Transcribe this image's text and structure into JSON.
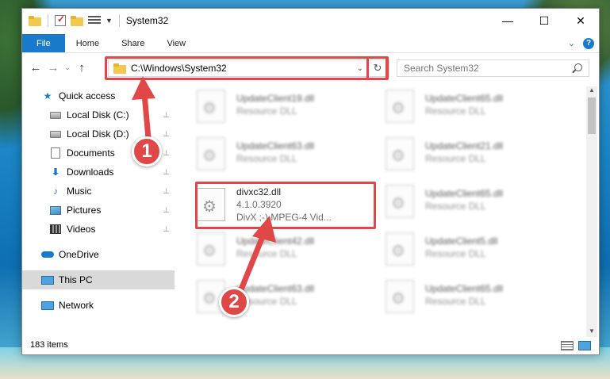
{
  "window": {
    "title": "System32",
    "controls": {
      "minimize": "—",
      "maximize": "☐",
      "close": "✕"
    }
  },
  "ribbon": {
    "tabs": [
      "File",
      "Home",
      "Share",
      "View"
    ],
    "expand": "⌄",
    "help": "?"
  },
  "nav": {
    "back": "←",
    "forward": "→",
    "recent": "⌄",
    "up": "↑",
    "address": "C:\\Windows\\System32",
    "address_dropdown": "⌄",
    "refresh": "↻",
    "search_placeholder": "Search System32"
  },
  "sidebar": {
    "items": [
      {
        "label": "Quick access",
        "icon": "star-icon",
        "pinned": false
      },
      {
        "label": "Local Disk (C:)",
        "icon": "drive-icon",
        "pinned": true
      },
      {
        "label": "Local Disk (D:)",
        "icon": "drive-icon",
        "pinned": true
      },
      {
        "label": "Documents",
        "icon": "document-icon",
        "pinned": true
      },
      {
        "label": "Downloads",
        "icon": "download-icon",
        "pinned": true
      },
      {
        "label": "Music",
        "icon": "music-icon",
        "pinned": true
      },
      {
        "label": "Pictures",
        "icon": "pictures-icon",
        "pinned": true
      },
      {
        "label": "Videos",
        "icon": "video-icon",
        "pinned": true
      },
      {
        "label": "OneDrive",
        "icon": "cloud-icon",
        "pinned": false
      },
      {
        "label": "This PC",
        "icon": "computer-icon",
        "pinned": false,
        "selected": true
      },
      {
        "label": "Network",
        "icon": "network-icon",
        "pinned": false
      }
    ],
    "pin_glyph": "📌"
  },
  "files": {
    "left": [
      {
        "name": "UpdateClient19.dll",
        "meta": "Resource DLL"
      },
      {
        "name": "UpdateClient63.dll",
        "meta": "Resource DLL"
      },
      {
        "name": "divxc32.dll",
        "meta": "4.1.0.3920",
        "meta2": "DivX ;-) MPEG-4 Vid...",
        "focus": true
      },
      {
        "name": "UpdateClient42.dll",
        "meta": "Resource DLL"
      },
      {
        "name": "UpdateClient63.dll",
        "meta": "Resource DLL"
      }
    ],
    "right": [
      {
        "name": "UpdateClient65.dll",
        "meta": "Resource DLL"
      },
      {
        "name": "UpdateClient21.dll",
        "meta": "Resource DLL"
      },
      {
        "name": "UpdateClient65.dll",
        "meta": "Resource DLL"
      },
      {
        "name": "UpdateClient5.dll",
        "meta": "Resource DLL"
      },
      {
        "name": "UpdateClient65.dll",
        "meta": "Resource DLL"
      }
    ]
  },
  "status": {
    "items": "183 items"
  },
  "annotations": {
    "step1": "1",
    "step2": "2",
    "color": "#e04848"
  }
}
